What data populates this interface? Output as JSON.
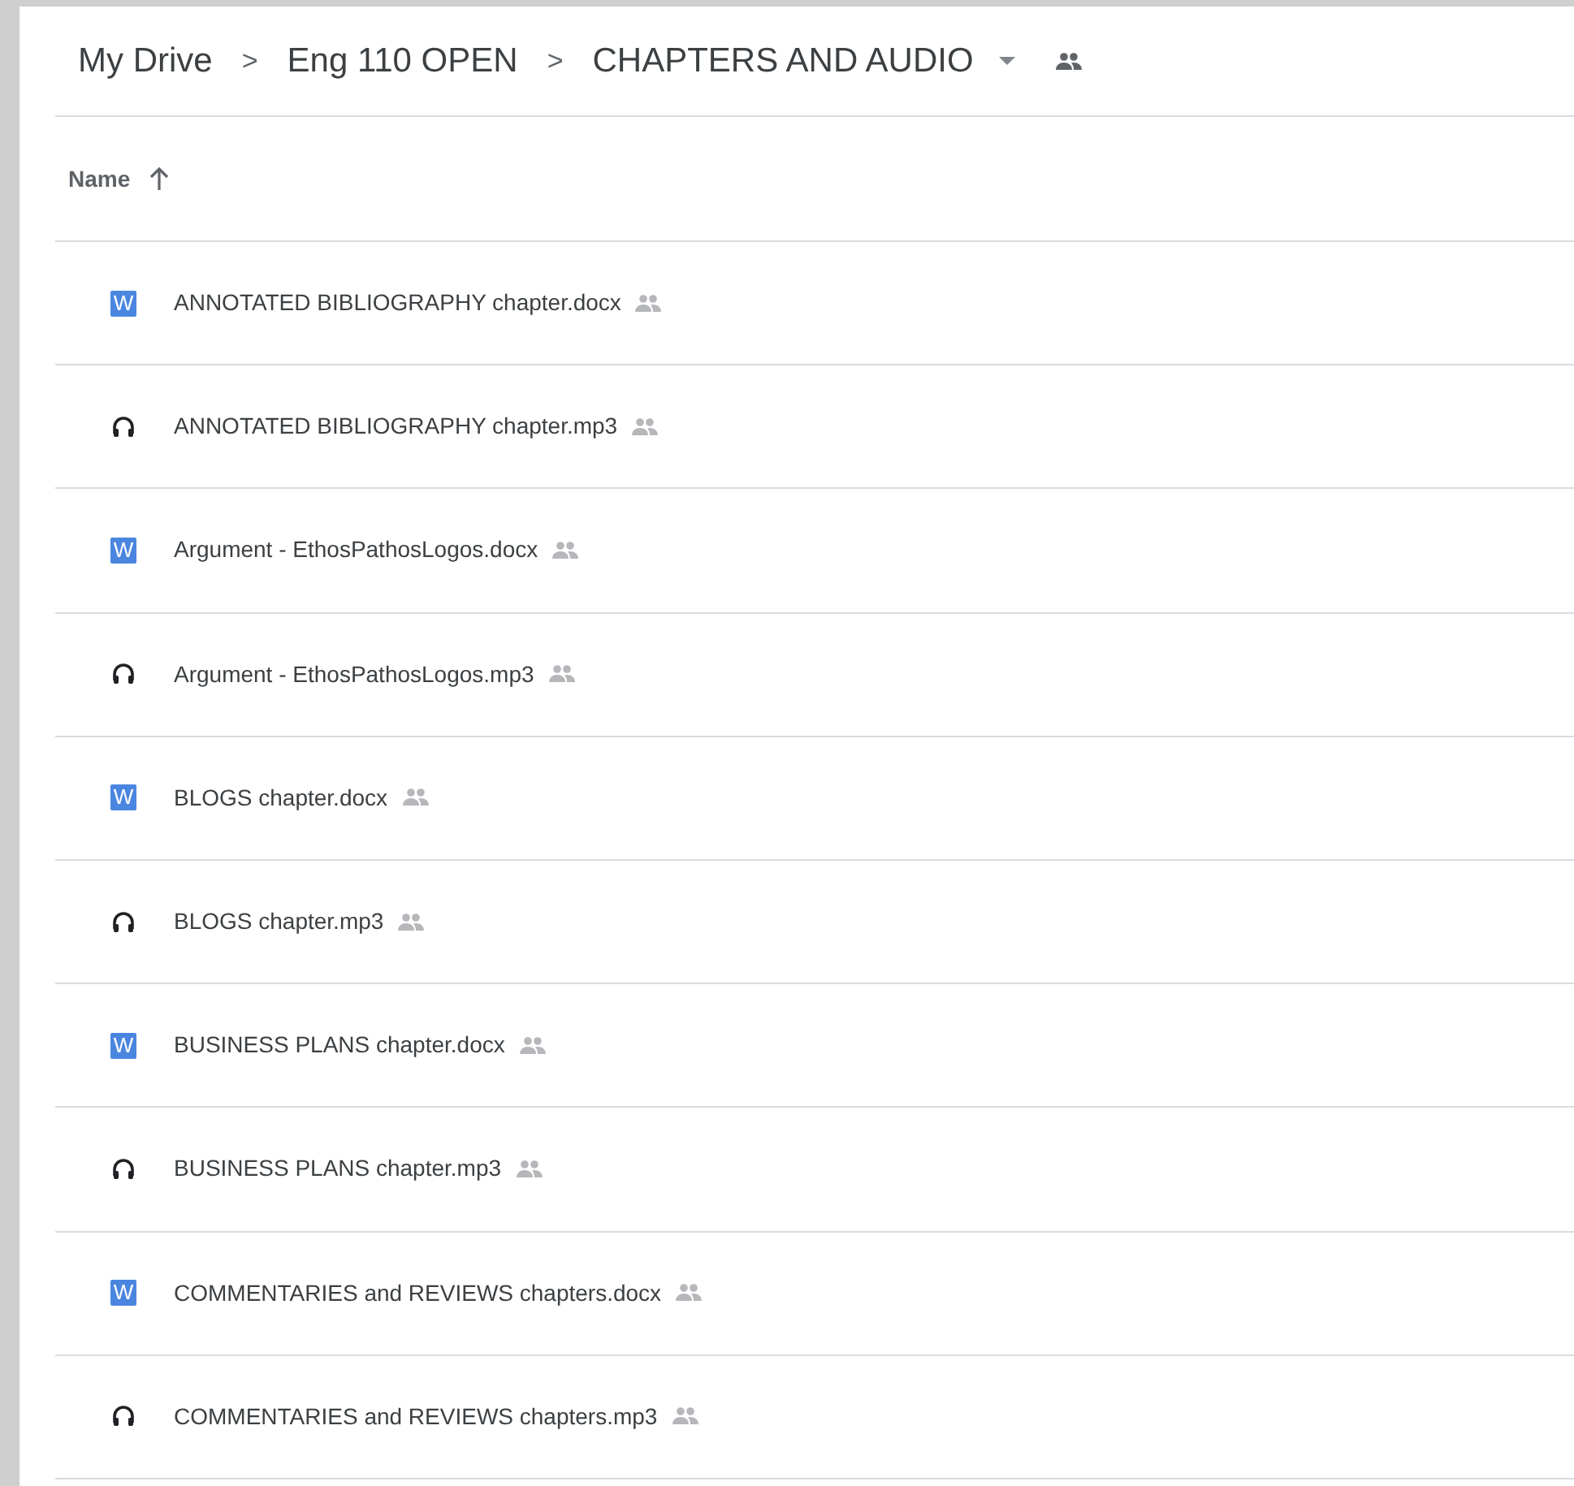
{
  "breadcrumb": [
    {
      "label": "My Drive"
    },
    {
      "label": "Eng 110 OPEN"
    },
    {
      "label": "CHAPTERS AND AUDIO"
    }
  ],
  "separator": ">",
  "column": {
    "label": "Name"
  },
  "files": [
    {
      "name": "ANNOTATED BIBLIOGRAPHY chapter.docx",
      "kind": "docx",
      "icon_letter": "W",
      "shared": true
    },
    {
      "name": "ANNOTATED BIBLIOGRAPHY chapter.mp3",
      "kind": "audio",
      "shared": true
    },
    {
      "name": "Argument - EthosPathosLogos.docx",
      "kind": "docx",
      "icon_letter": "W",
      "shared": true
    },
    {
      "name": "Argument - EthosPathosLogos.mp3",
      "kind": "audio",
      "shared": true
    },
    {
      "name": "BLOGS chapter.docx",
      "kind": "docx",
      "icon_letter": "W",
      "shared": true
    },
    {
      "name": "BLOGS chapter.mp3",
      "kind": "audio",
      "shared": true
    },
    {
      "name": "BUSINESS PLANS chapter.docx",
      "kind": "docx",
      "icon_letter": "W",
      "shared": true
    },
    {
      "name": "BUSINESS PLANS chapter.mp3",
      "kind": "audio",
      "shared": true
    },
    {
      "name": "COMMENTARIES and REVIEWS chapters.docx",
      "kind": "docx",
      "icon_letter": "W",
      "shared": true
    },
    {
      "name": "COMMENTARIES and REVIEWS chapters.mp3",
      "kind": "audio",
      "shared": true
    }
  ]
}
